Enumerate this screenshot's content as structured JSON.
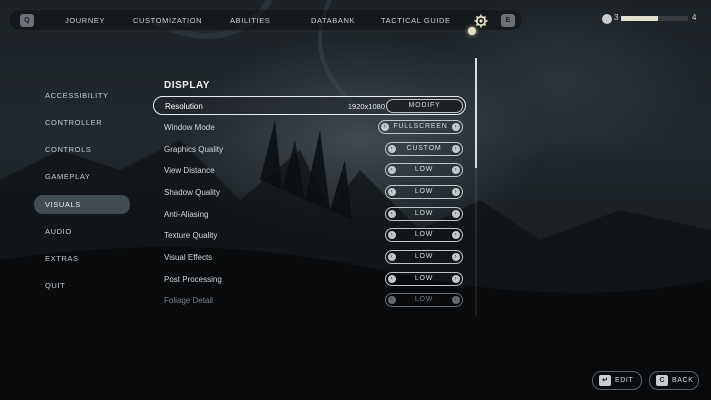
{
  "topnav": {
    "left_key": "Q",
    "right_key": "E",
    "tabs": [
      {
        "label": "JOURNEY"
      },
      {
        "label": "CUSTOMIZATION"
      },
      {
        "label": "ABILITIES"
      },
      {
        "label": "DATABANK"
      },
      {
        "label": "TACTICAL GUIDE"
      }
    ],
    "active_icon": "gear-icon"
  },
  "level": {
    "current": "3",
    "next": "4",
    "progress_fraction": 0.55
  },
  "categories": [
    {
      "label": "ACCESSIBILITY",
      "active": false
    },
    {
      "label": "CONTROLLER",
      "active": false
    },
    {
      "label": "CONTROLS",
      "active": false
    },
    {
      "label": "GAMEPLAY",
      "active": false
    },
    {
      "label": "VISUALS",
      "active": true
    },
    {
      "label": "AUDIO",
      "active": false
    },
    {
      "label": "EXTRAS",
      "active": false
    },
    {
      "label": "QUIT",
      "active": false
    }
  ],
  "panel": {
    "section_title": "DISPLAY",
    "resolution": {
      "label": "Resolution",
      "value": "1920x1080",
      "button": "MODIFY"
    },
    "settings": [
      {
        "label": "Window Mode",
        "value": "FULLSCREEN"
      },
      {
        "label": "Graphics Quality",
        "value": "CUSTOM"
      },
      {
        "label": "View Distance",
        "value": "LOW"
      },
      {
        "label": "Shadow Quality",
        "value": "LOW"
      },
      {
        "label": "Anti-Aliasing",
        "value": "LOW"
      },
      {
        "label": "Texture Quality",
        "value": "LOW"
      },
      {
        "label": "Visual Effects",
        "value": "LOW"
      },
      {
        "label": "Post Processing",
        "value": "LOW"
      },
      {
        "label": "Foliage Detail",
        "value": "LOW"
      }
    ]
  },
  "footer": {
    "edit": {
      "key": "↵",
      "label": "EDIT"
    },
    "back": {
      "key": "C",
      "label": "BACK"
    }
  },
  "colors": {
    "accent": "#e6e2c8",
    "selected_bg": "#96a6b4"
  }
}
